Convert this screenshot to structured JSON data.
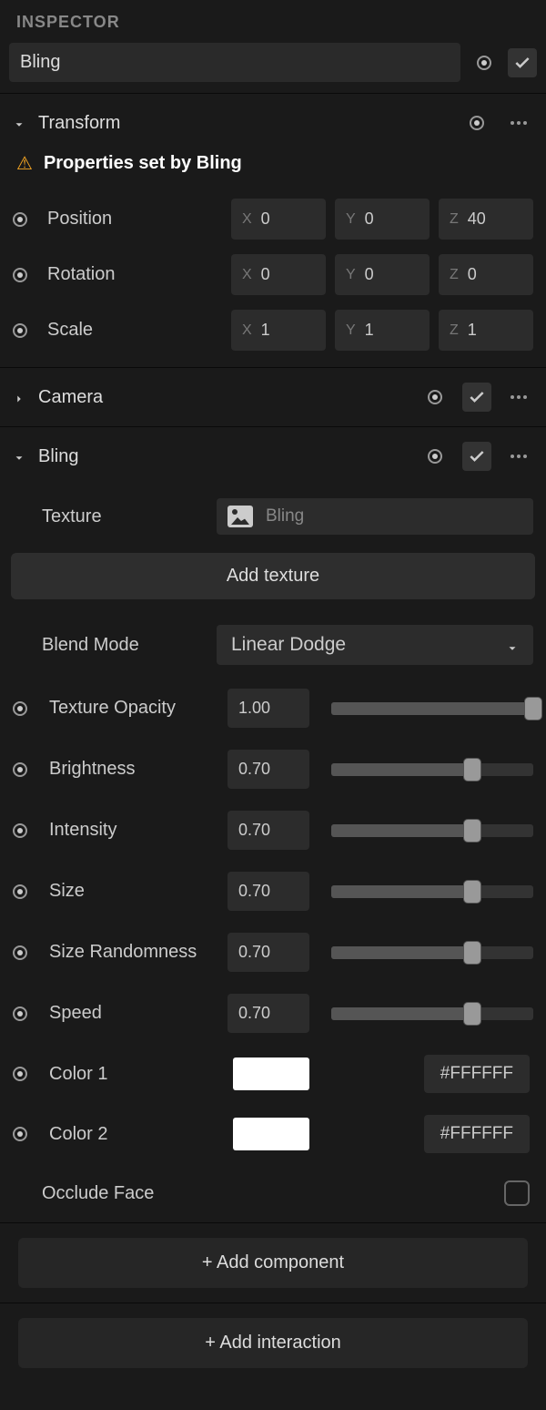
{
  "panel_title": "INSPECTOR",
  "object_name": "Bling",
  "transform": {
    "title": "Transform",
    "warning": "Properties set by Bling",
    "position": {
      "label": "Position",
      "x": "0",
      "y": "0",
      "z": "40"
    },
    "rotation": {
      "label": "Rotation",
      "x": "0",
      "y": "0",
      "z": "0"
    },
    "scale": {
      "label": "Scale",
      "x": "1",
      "y": "1",
      "z": "1"
    }
  },
  "camera": {
    "title": "Camera"
  },
  "bling": {
    "title": "Bling",
    "texture_label": "Texture",
    "texture_name": "Bling",
    "add_texture": "Add texture",
    "blend_mode_label": "Blend Mode",
    "blend_mode_value": "Linear Dodge",
    "sliders": [
      {
        "label": "Texture Opacity",
        "value": "1.00",
        "pct": 100
      },
      {
        "label": "Brightness",
        "value": "0.70",
        "pct": 70
      },
      {
        "label": "Intensity",
        "value": "0.70",
        "pct": 70
      },
      {
        "label": "Size",
        "value": "0.70",
        "pct": 70
      },
      {
        "label": "Size Randomness",
        "value": "0.70",
        "pct": 70
      },
      {
        "label": "Speed",
        "value": "0.70",
        "pct": 70
      }
    ],
    "color1": {
      "label": "Color 1",
      "hex": "#FFFFFF"
    },
    "color2": {
      "label": "Color 2",
      "hex": "#FFFFFF"
    },
    "occlude_label": "Occlude Face"
  },
  "add_component": "+ Add component",
  "add_interaction": "+ Add interaction"
}
